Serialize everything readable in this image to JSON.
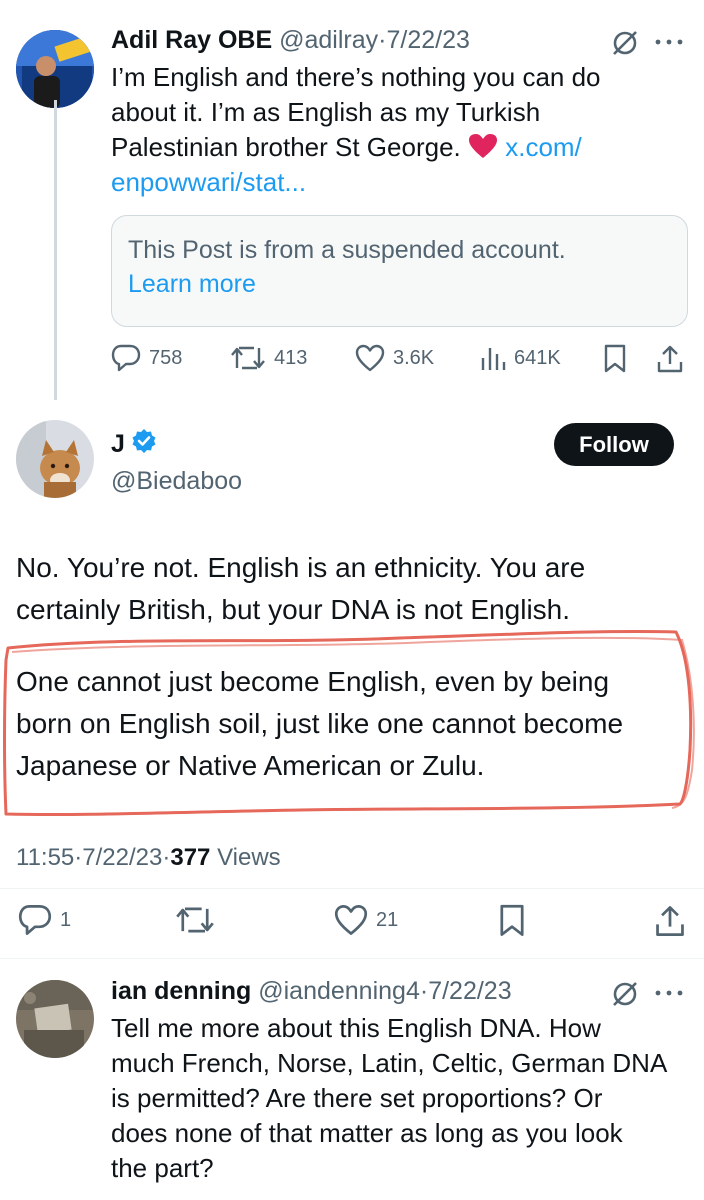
{
  "tweet1": {
    "name": "Adil Ray OBE",
    "handle": "@adilray",
    "dot": "·",
    "date": "7/22/23",
    "text_lines": [
      "I’m English and there’s nothing you can do",
      "about it. I’m as English as my Turkish",
      "Palestinian brother St George. "
    ],
    "link_part1": "x.com/",
    "link_part2": "enpowwari/stat...",
    "quote_text": "This Post is from a suspended account.",
    "quote_link": "Learn more",
    "replies": "758",
    "reposts": "413",
    "likes": "3.6K",
    "views": "641K"
  },
  "tweet2": {
    "name": "J",
    "handle": "@Biedaboo",
    "follow_label": "Follow",
    "para1_lines": [
      "No. You’re not. English is an ethnicity.  You are",
      "certainly British, but your DNA is not English."
    ],
    "para2_lines": [
      "One cannot just become English, even by being",
      "born on English soil, just like one cannot become",
      "Japanese or Native American or Zulu."
    ],
    "time": "11:55",
    "dot": "·",
    "date": "7/22/23",
    "views_count": "377",
    "views_label": "Views",
    "replies": "1",
    "likes": "21"
  },
  "tweet3": {
    "name": "ian denning",
    "handle": "@iandenning4",
    "dot": "·",
    "date": "7/22/23",
    "text_lines": [
      "Tell me more about this English DNA. How",
      "much French, Norse, Latin, Celtic, German DNA",
      "is permitted? Are there set proportions? Or",
      "does none of that matter as long as you look",
      "the part?"
    ]
  },
  "colors": {
    "text": "#0f1419",
    "secondary": "#536471",
    "link": "#1d9bf0",
    "verified": "#1d9bf0",
    "annotation": "#e5685a",
    "heart": "#e0245e"
  },
  "icons": [
    "reply-icon",
    "repost-icon",
    "like-icon",
    "views-icon",
    "bookmark-icon",
    "share-icon",
    "grok-icon",
    "more-icon",
    "verified-badge-icon",
    "heart-emoji-icon"
  ]
}
